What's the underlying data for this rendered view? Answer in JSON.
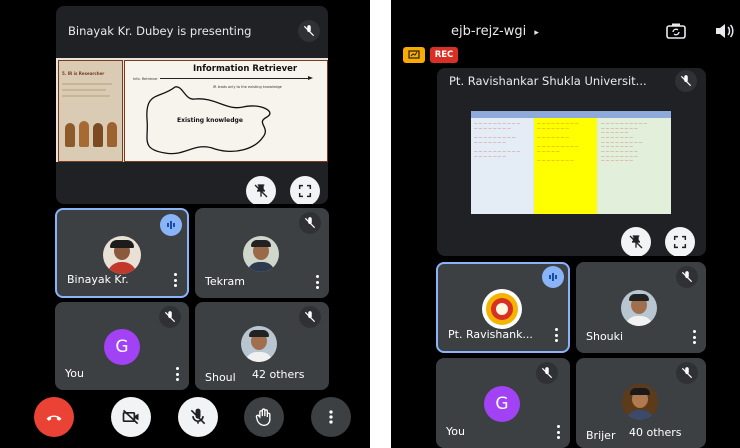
{
  "left": {
    "presentation": {
      "title": "Binayak Kr. Dubey is presenting",
      "slide": {
        "title": "Information Retriever",
        "arrow_label": "IR leads only to the existing knowledge",
        "ir_label": "Info. Retriever",
        "region_label": "Existing knowledge",
        "side_heading": "5. IR is Researcher"
      }
    },
    "tiles": [
      {
        "name": "Binayak Kr.",
        "speaking": true
      },
      {
        "name": "Tekram",
        "speaking": false
      },
      {
        "name": "You",
        "initial": "G",
        "speaking": false
      },
      {
        "name": "Shoul",
        "others": "42 others",
        "speaking": false
      }
    ],
    "controls": [
      "end-call",
      "camera-off",
      "mic-off",
      "raise-hand",
      "more"
    ]
  },
  "right": {
    "meeting_code": "ejb-rejz-wgi",
    "rec_label": "REC",
    "presentation": {
      "title": "Pt. Ravishankar Shukla Universit..."
    },
    "tiles": [
      {
        "name": "Pt. Ravishank...",
        "speaking": true
      },
      {
        "name": "Shouki",
        "speaking": false
      },
      {
        "name": "You",
        "initial": "G",
        "speaking": false
      },
      {
        "name": "Brijer",
        "others": "40 others",
        "speaking": false
      }
    ]
  },
  "colors": {
    "background": "#000000",
    "tile": "#3c4043",
    "active_border": "#8ab4f8",
    "end_call": "#ea4335",
    "avatar_g": "#a142f4",
    "rec": "#d93025",
    "yellow_badge": "#f9ab00"
  }
}
